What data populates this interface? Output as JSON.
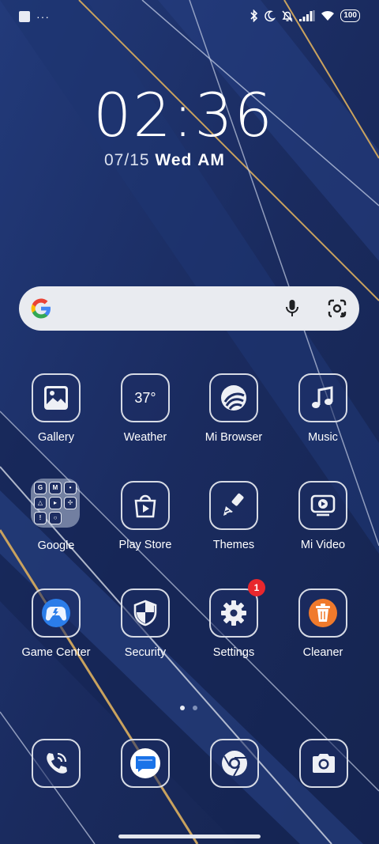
{
  "status_bar": {
    "dots": "···",
    "battery": "100"
  },
  "lock": {
    "time": "02:36",
    "date": "07/15",
    "weekday": "Wed",
    "ampm": "AM"
  },
  "search": {
    "placeholder": ""
  },
  "apps": [
    {
      "label": "Gallery",
      "icon": "gallery-icon"
    },
    {
      "label": "Weather",
      "icon": "weather-icon",
      "temp": "37°"
    },
    {
      "label": "Mi Browser",
      "icon": "mi-browser-icon"
    },
    {
      "label": "Music",
      "icon": "music-icon"
    },
    {
      "label": "Google",
      "icon": "google-folder-icon"
    },
    {
      "label": "Play Store",
      "icon": "play-store-icon"
    },
    {
      "label": "Themes",
      "icon": "themes-icon"
    },
    {
      "label": "Mi Video",
      "icon": "mi-video-icon"
    },
    {
      "label": "Game Center",
      "icon": "game-center-icon"
    },
    {
      "label": "Security",
      "icon": "security-icon"
    },
    {
      "label": "Settings",
      "icon": "settings-icon",
      "badge": "1"
    },
    {
      "label": "Cleaner",
      "icon": "cleaner-icon"
    }
  ],
  "dock": [
    {
      "icon": "phone-icon"
    },
    {
      "icon": "messages-icon"
    },
    {
      "icon": "chrome-icon"
    },
    {
      "icon": "camera-icon"
    }
  ],
  "colors": {
    "background": "#1b2d63",
    "badge": "#e8272d",
    "accent_gold": "#c9a25e"
  }
}
